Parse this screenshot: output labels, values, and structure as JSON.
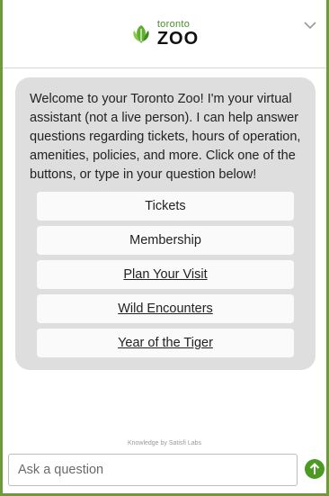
{
  "header": {
    "logo_top": "toronto",
    "logo_bottom": "ZOO"
  },
  "message": {
    "text": "Welcome to your Toronto Zoo! I'm your virtual assistant (not a live person). I can help answer questions regarding tickets, hours of operation, amenities, policies, and more. Click one of the buttons, or type in your question below!"
  },
  "quick_replies": [
    {
      "label": "Tickets"
    },
    {
      "label": "Membership"
    },
    {
      "label": "Plan Your Visit"
    },
    {
      "label": "Wild Encounters"
    },
    {
      "label": "Year of the Tiger"
    }
  ],
  "footer": {
    "powered_by": "Knowledge by Satisfi Labs"
  },
  "composer": {
    "placeholder": "Ask a question"
  },
  "colors": {
    "brand_green": "#4d9a23",
    "border_green": "#6d9b3a",
    "bubble_gray": "#dedede"
  },
  "icons": {
    "logo": "toronto-zoo-leaf-logo",
    "collapse": "chevron-down-icon",
    "send": "arrow-up-icon"
  }
}
